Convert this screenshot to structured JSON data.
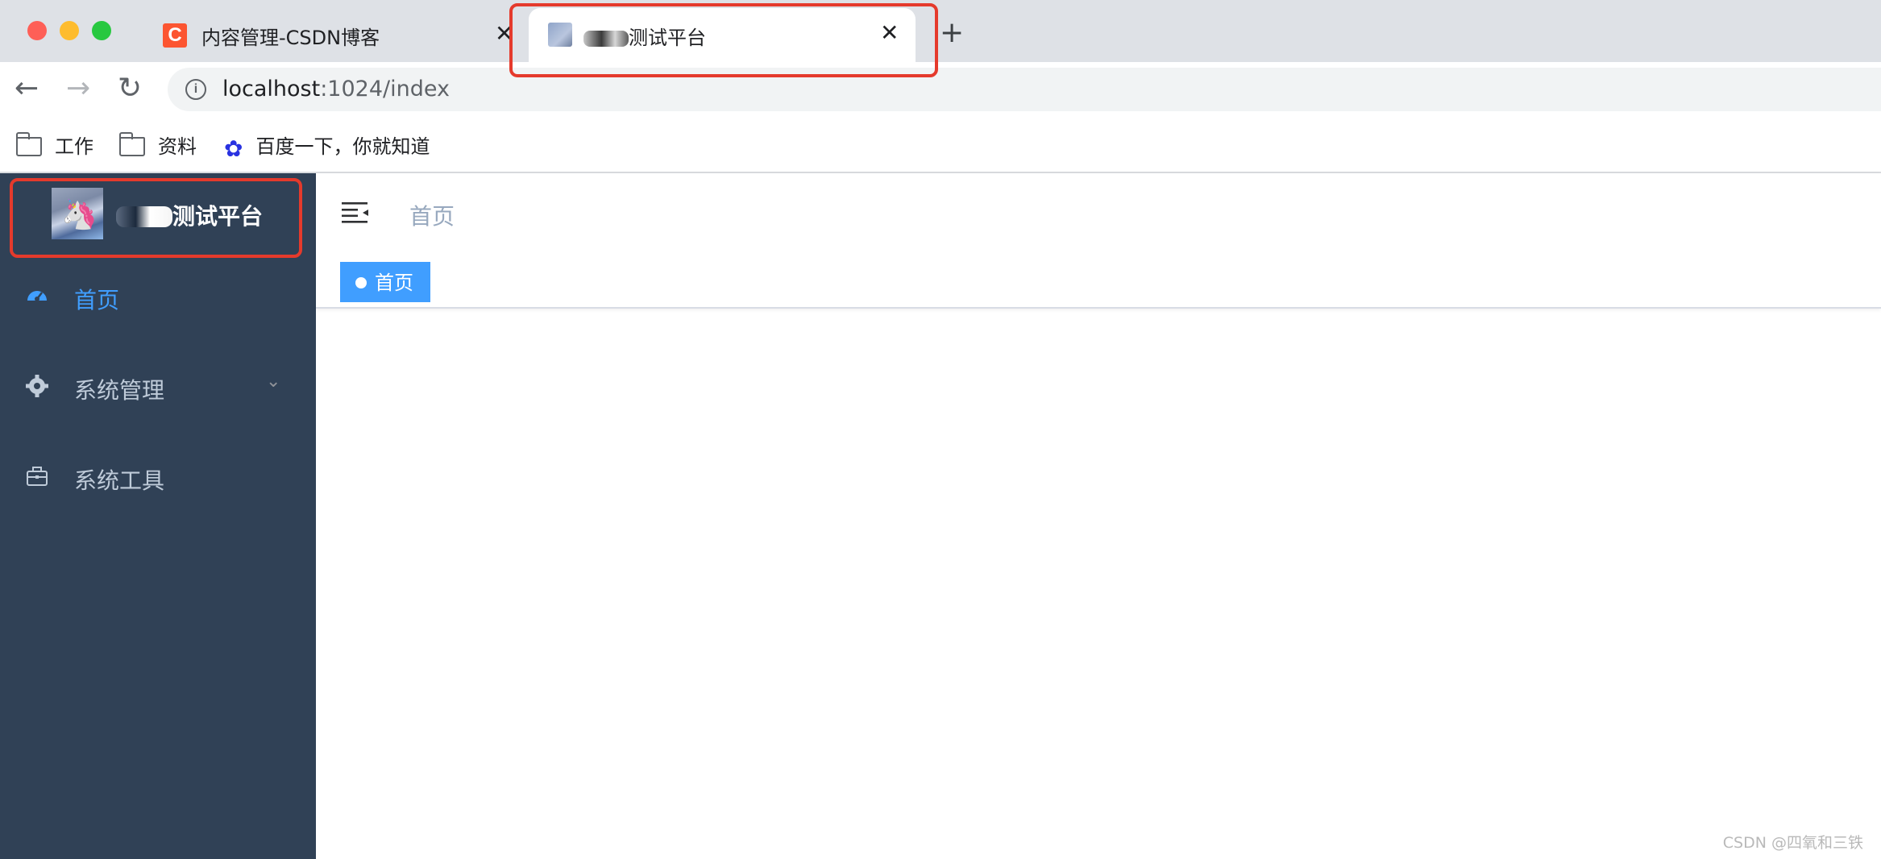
{
  "browser": {
    "tabs": [
      {
        "title": "内容管理-CSDN博客",
        "favicon": "C",
        "close": "✕"
      },
      {
        "title_suffix": "测试平台",
        "close": "✕"
      }
    ],
    "new_tab": "+",
    "url_host": "localhost",
    "url_rest": ":1024/index",
    "info_icon": "i",
    "bookmarks": [
      {
        "label": "工作",
        "icon": "folder-icon"
      },
      {
        "label": "资料",
        "icon": "folder-icon"
      },
      {
        "label": "百度一下，你就知道",
        "icon": "baidu-paw-icon"
      }
    ]
  },
  "sidebar": {
    "logo_suffix": "测试平台",
    "menu": [
      {
        "label": "首页",
        "icon": "dashboard-icon",
        "active": true
      },
      {
        "label": "系统管理",
        "icon": "settings-icon",
        "has_children": true
      },
      {
        "label": "系统工具",
        "icon": "toolbox-icon"
      }
    ]
  },
  "navbar": {
    "breadcrumb": "首页"
  },
  "tagsview": {
    "tags": [
      {
        "label": "首页",
        "active": true
      }
    ]
  },
  "watermark": "CSDN @四氧和三铁",
  "colors": {
    "sidebar_bg": "#304156",
    "accent": "#409eff",
    "annotation_red": "#e53a2c"
  }
}
